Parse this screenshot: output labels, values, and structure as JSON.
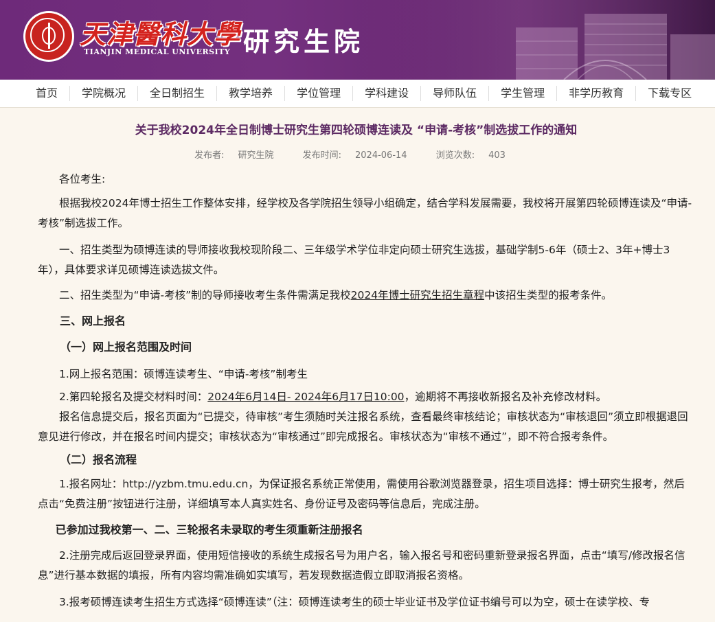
{
  "header": {
    "cn_name": "天津醫科大學",
    "en_name": "TIANJIN MEDICAL UNIVERSITY",
    "dept": "研究生院"
  },
  "nav": [
    {
      "label": "首页",
      "name": "nav-home"
    },
    {
      "label": "学院概况",
      "name": "nav-overview"
    },
    {
      "label": "全日制招生",
      "name": "nav-admissions"
    },
    {
      "label": "教学培养",
      "name": "nav-teaching"
    },
    {
      "label": "学位管理",
      "name": "nav-degree"
    },
    {
      "label": "学科建设",
      "name": "nav-discipline"
    },
    {
      "label": "导师队伍",
      "name": "nav-supervisors"
    },
    {
      "label": "学生管理",
      "name": "nav-students"
    },
    {
      "label": "非学历教育",
      "name": "nav-nondegree"
    },
    {
      "label": "下载专区",
      "name": "nav-downloads"
    }
  ],
  "article": {
    "title": "关于我校2024年全日制博士研究生第四轮硕博连读及 “申请-考核”制选拔工作的通知",
    "publisher_label": "发布者:",
    "publisher": "研究生院",
    "date_label": "发布时间:",
    "date": "2024-06-14",
    "views_label": "浏览次数:",
    "views": "403",
    "greeting": "各位考生:",
    "p1": "根据我校2024年博士招生工作整体安排，经学校及各学院招生领导小组确定，结合学科发展需要，我校将开展第四轮硕博连读及“申请-考核”制选拔工作。",
    "p2": "一、招生类型为硕博连读的导师接收我校现阶段二、三年级学术学位非定向硕士研究生选拔，基础学制5-6年（硕士2、3年+博士3年），具体要求详见硕博连读选拔文件。",
    "p3_a": "二、招生类型为“申请-考核”制的导师接收考生条件需满足我校",
    "p3_link": "2024年博士研究生招生章程",
    "p3_b": "中该招生类型的报考条件。",
    "h_online": "三、网上报名",
    "h_scope": "（一）网上报名范围及时间",
    "scope1": "1.网上报名范围：硕博连读考生、“申请-考核”制考生",
    "scope2_a": "2.第四轮报名及提交材料时间：",
    "scope2_link": "2024年6月14日- 2024年6月17日10:00",
    "scope2_b": "，逾期将不再接收新报名及补充修改材料。",
    "p_review": "报名信息提交后，报名页面为“已提交，待审核”考生须随时关注报名系统，查看最终审核结论；审核状态为“审核退回”须立即根据退回意见进行修改，并在报名时间内提交；审核状态为“审核通过”即完成报名。审核状态为“审核不通过”，即不符合报考条件。",
    "h_process": "（二）报名流程",
    "proc1": "1.报名网址：http://yzbm.tmu.edu.cn，为保证报名系统正常使用，需使用谷歌浏览器登录，招生项目选择：博士研究生报考，然后点击“免费注册”按钮进行注册，详细填写本人真实姓名、身份证号及密码等信息后，完成注册。",
    "h_reregister": "已参加过我校第一、二、三轮报名未录取的考生须重新注册报名",
    "proc2": "2.注册完成后返回登录界面，使用短信接收的系统生成报名号为用户名，输入报名号和密码重新登录报名界面，点击“填写/修改报名信息”进行基本数据的填报，所有内容均需准确如实填写，若发现数据造假立即取消报名资格。",
    "proc3": "3.报考硕博连读考生招生方式选择“硕博连读”（注：硕博连读考生的硕士毕业证书及学位证书编号可以为空，硕士在读学校、专"
  }
}
